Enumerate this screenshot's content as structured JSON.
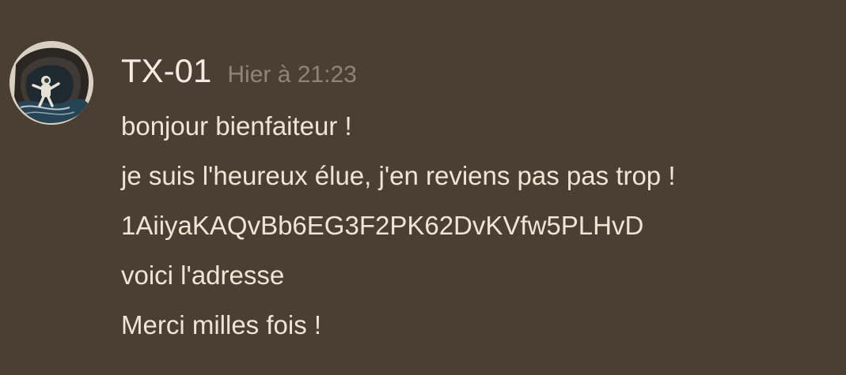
{
  "message": {
    "author": "TX-01",
    "timestamp": "Hier à 21:23",
    "avatar_icon": "astronaut-avatar-icon",
    "lines": [
      "bonjour bienfaiteur !",
      "je suis l'heureux élue, j'en reviens pas pas trop !",
      "1AiiyaKAQvBb6EG3F2PK62DvKVfw5PLHvD",
      "voici l'adresse",
      "Merci milles fois !"
    ]
  },
  "colors": {
    "background": "#4b3e33",
    "author": "#f4ece2",
    "timestamp": "#8f8478",
    "text": "#efe4d6"
  }
}
